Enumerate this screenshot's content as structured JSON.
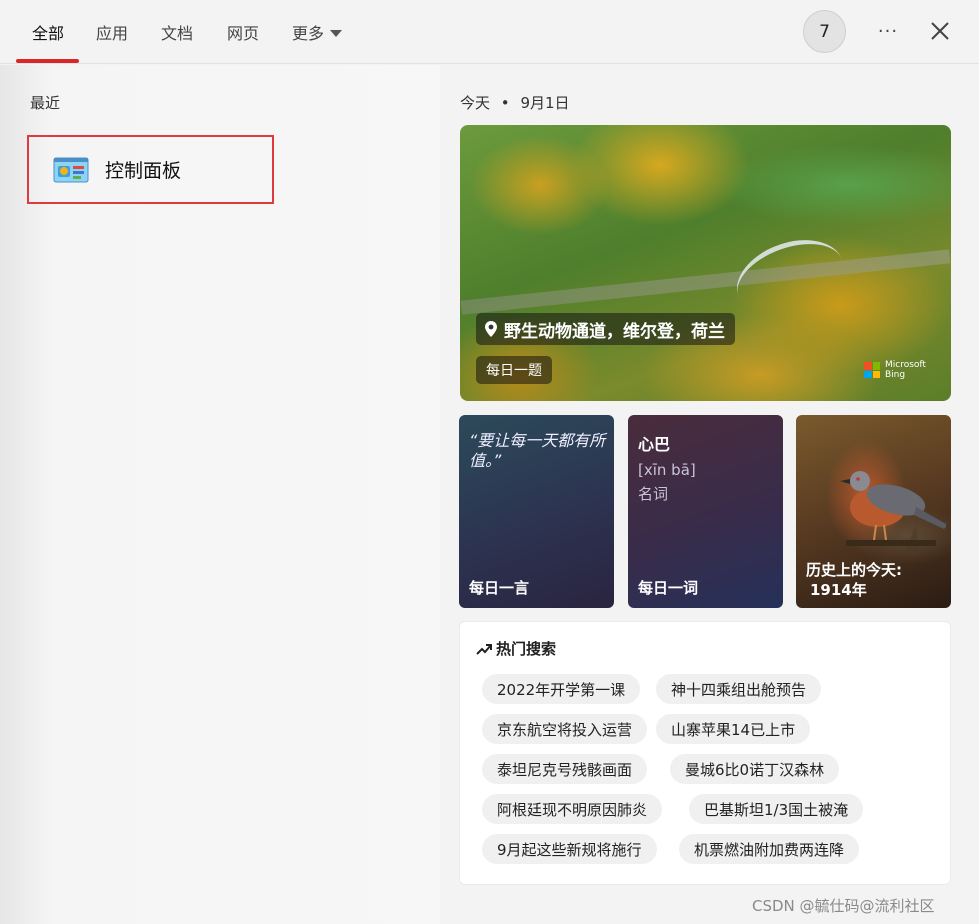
{
  "tabs": [
    {
      "label": "全部",
      "active": true
    },
    {
      "label": "应用"
    },
    {
      "label": "文档"
    },
    {
      "label": "网页"
    },
    {
      "label": "更多"
    }
  ],
  "header": {
    "avatar_text": "7",
    "more_options_label": "···"
  },
  "recent": {
    "label": "最近",
    "items": [
      {
        "label": "控制面板",
        "icon": "control-panel-icon"
      }
    ]
  },
  "today": {
    "label": "今天",
    "separator": "•",
    "date": "9月1日"
  },
  "hero": {
    "location": "野生动物通道，维尔登，荷兰",
    "daily_quiz": "每日一题",
    "brand_line1": "Microsoft",
    "brand_line2": "Bing"
  },
  "cards": {
    "quote": {
      "text": "“要让每一天都有所值。”",
      "footer": "每日一言"
    },
    "word": {
      "title": "心巴",
      "pinyin": "[xīn bā]",
      "pos": "名词",
      "footer": "每日一词"
    },
    "history": {
      "title": "历史上的今天:",
      "year": "1914年"
    }
  },
  "hot_search": {
    "title": "热门搜索",
    "chips": [
      "2022年开学第一课",
      "神十四乘组出舱预告",
      "京东航空将投入运营",
      "山寨苹果14已上市",
      "泰坦尼克号残骸画面",
      "曼城6比0诺丁汉森林",
      "阿根廷现不明原因肺炎",
      "巴基斯坦1/3国土被淹",
      "9月起这些新规将施行",
      "机票燃油附加费两连降"
    ]
  },
  "watermark": "CSDN @毓仕码@流利社区",
  "colors": {
    "accent": "#d9262b",
    "highlight_border": "#e0393e",
    "background": "#f3f3f3"
  }
}
